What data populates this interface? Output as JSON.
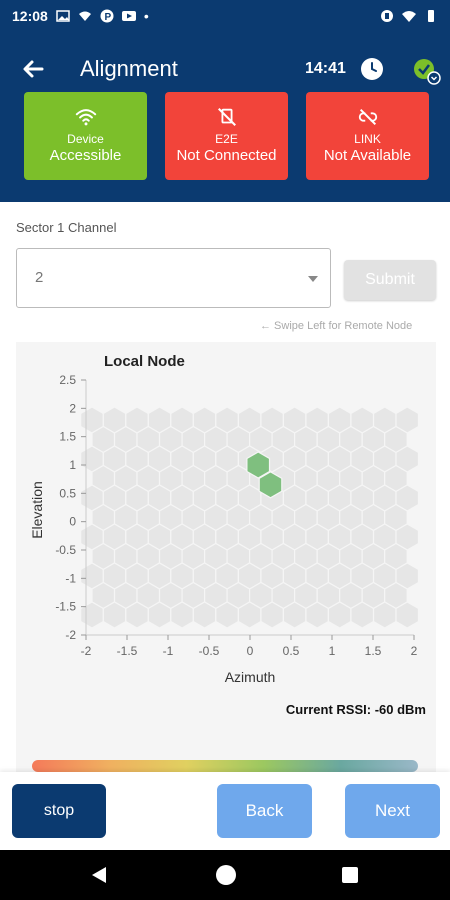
{
  "status_bar": {
    "time": "12:08",
    "dot": "•"
  },
  "header": {
    "title": "Alignment",
    "time": "14:41",
    "tiles": [
      {
        "line1": "Device",
        "line2": "Accessible",
        "icon": "wifi-icon",
        "color": "#7cbf2a"
      },
      {
        "line1": "E2E",
        "line2": "Not Connected",
        "icon": "no-connection-icon",
        "color": "#f2443a"
      },
      {
        "line1": "LINK",
        "line2": "Not Available",
        "icon": "link-off-icon",
        "color": "#f2443a"
      }
    ]
  },
  "form": {
    "label": "Sector 1 Channel",
    "selected": "2",
    "submit_label": "Submit",
    "swipe_hint": "← Swipe Left for Remote Node"
  },
  "chart_data": {
    "type": "heatmap",
    "title": "Local Node",
    "xlabel": "Azimuth",
    "ylabel": "Elevation",
    "xlim": [
      -2,
      2
    ],
    "ylim": [
      -2,
      2.5
    ],
    "xticks": [
      "-2",
      "-1.5",
      "-1",
      "-0.5",
      "0",
      "0.5",
      "1",
      "1.5",
      "2"
    ],
    "yticks": [
      "2.5",
      "2",
      "1.5",
      "1",
      "0.5",
      "0",
      "-0.5",
      "-1",
      "-1.5",
      "-2"
    ],
    "highlighted_cells": [
      {
        "x": 0.1,
        "y": 1.0,
        "color": "#7fbf7f"
      },
      {
        "x": 0.25,
        "y": 0.65,
        "color": "#7fbf7f"
      }
    ],
    "cell_color": "#e6e6e6",
    "rssi_label": "Current RSSI: -60 dBm"
  },
  "buttons": {
    "stop": "stop",
    "back": "Back",
    "next": "Next"
  }
}
